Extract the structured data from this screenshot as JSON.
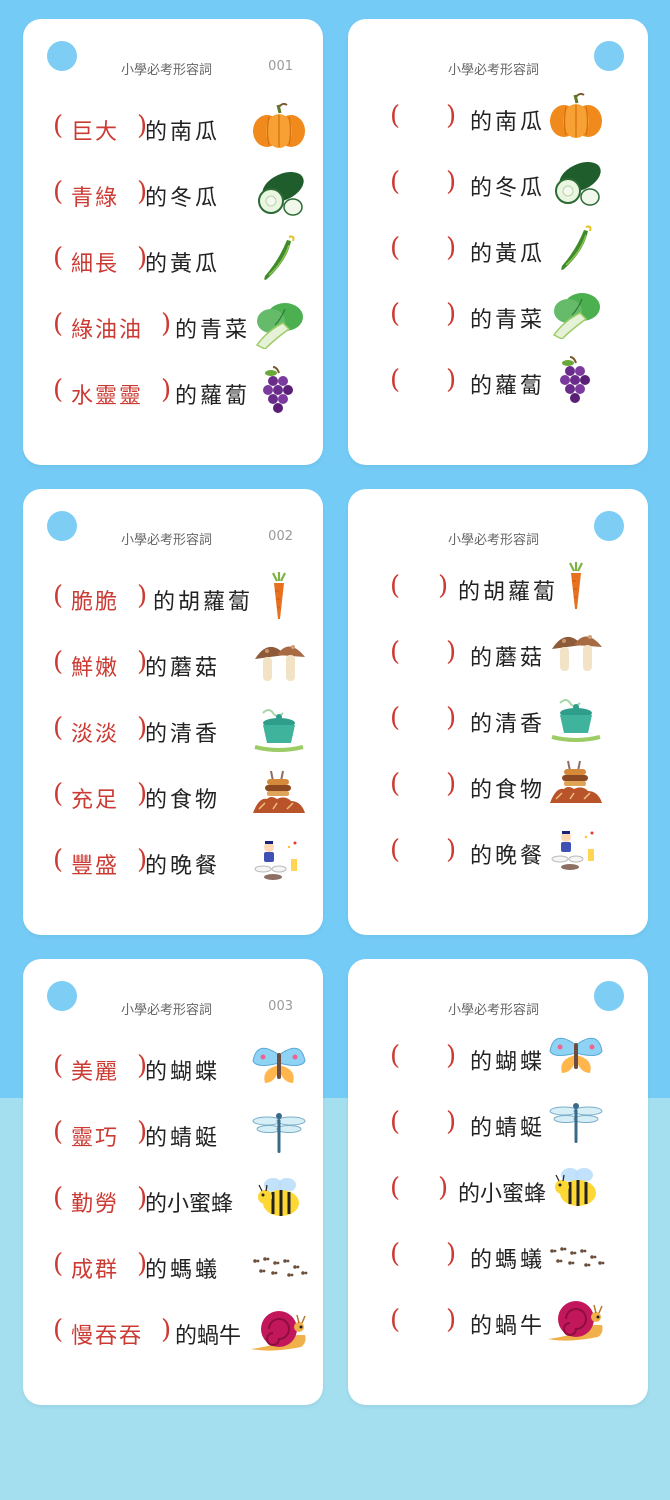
{
  "cards": [
    {
      "title": "小學必考形容詞",
      "number": "001",
      "rows": [
        {
          "adj": "巨大",
          "noun": "的南瓜",
          "icon": "pumpkin-icon"
        },
        {
          "adj": "青綠",
          "noun": "的冬瓜",
          "icon": "winter-melon-icon"
        },
        {
          "adj": "細長",
          "noun": "的黃瓜",
          "icon": "cucumber-icon"
        },
        {
          "adj": "綠油油",
          "noun": "的青菜",
          "icon": "bok-choy-icon"
        },
        {
          "adj": "水靈靈",
          "noun": "的蘿蔔",
          "icon": "grapes-icon"
        }
      ]
    },
    {
      "title": "小學必考形容詞",
      "rows": [
        {
          "noun": "的南瓜",
          "icon": "pumpkin-icon"
        },
        {
          "noun": "的冬瓜",
          "icon": "winter-melon-icon"
        },
        {
          "noun": "的黃瓜",
          "icon": "cucumber-icon"
        },
        {
          "noun": "的青菜",
          "icon": "bok-choy-icon"
        },
        {
          "noun": "的蘿蔔",
          "icon": "grapes-icon"
        }
      ]
    },
    {
      "title": "小學必考形容詞",
      "number": "002",
      "rows": [
        {
          "adj": "脆脆",
          "noun": "的胡蘿蔔",
          "icon": "carrot-icon"
        },
        {
          "adj": "鮮嫩",
          "noun": "的蘑菇",
          "icon": "mushroom-icon"
        },
        {
          "adj": "淡淡",
          "noun": "的清香",
          "icon": "steaming-pot-icon"
        },
        {
          "adj": "充足",
          "noun": "的食物",
          "icon": "food-pile-icon"
        },
        {
          "adj": "豐盛",
          "noun": "的晚餐",
          "icon": "dinner-icon"
        }
      ]
    },
    {
      "title": "小學必考形容詞",
      "rows": [
        {
          "noun": "的胡蘿蔔",
          "icon": "carrot-icon"
        },
        {
          "noun": "的蘑菇",
          "icon": "mushroom-icon"
        },
        {
          "noun": "的清香",
          "icon": "steaming-pot-icon"
        },
        {
          "noun": "的食物",
          "icon": "food-pile-icon"
        },
        {
          "noun": "的晚餐",
          "icon": "dinner-icon"
        }
      ]
    },
    {
      "title": "小學必考形容詞",
      "number": "003",
      "rows": [
        {
          "adj": "美麗",
          "noun": "的蝴蝶",
          "icon": "butterfly-icon"
        },
        {
          "adj": "靈巧",
          "noun": "的蜻蜓",
          "icon": "dragonfly-icon"
        },
        {
          "adj": "勤勞",
          "noun": "的小蜜蜂",
          "icon": "bee-icon"
        },
        {
          "adj": "成群",
          "noun": "的螞蟻",
          "icon": "ants-icon"
        },
        {
          "adj": "慢吞吞",
          "noun": "的蝸牛",
          "icon": "snail-icon"
        }
      ]
    },
    {
      "title": "小學必考形容詞",
      "rows": [
        {
          "noun": "的蝴蝶",
          "icon": "butterfly-icon"
        },
        {
          "noun": "的蜻蜓",
          "icon": "dragonfly-icon"
        },
        {
          "noun": "的小蜜蜂",
          "icon": "bee-icon"
        },
        {
          "noun": "的螞蟻",
          "icon": "ants-icon"
        },
        {
          "noun": "的蝸牛",
          "icon": "snail-icon"
        }
      ]
    }
  ]
}
